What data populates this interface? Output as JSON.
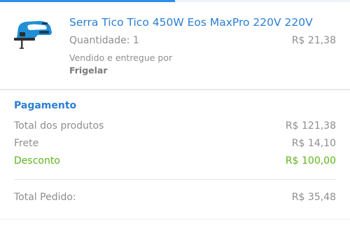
{
  "progress": {
    "fraction": 0.5,
    "color": "#2d8fe8"
  },
  "product": {
    "image_icon": "jigsaw-icon",
    "name": "Serra Tico Tico 450W Eos MaxPro 220V 220V",
    "quantity_label": "Quantidade: 1",
    "price": "R$ 21,38",
    "seller_label": "Vendido e entregue por",
    "seller_name": "Frigelar"
  },
  "payment": {
    "title": "Pagamento",
    "products_label": "Total dos produtos",
    "products_value": "R$ 121,38",
    "shipping_label": "Frete",
    "shipping_value": "R$ 14,10",
    "discount_label": "Desconto",
    "discount_value": "R$ 100,00",
    "total_label": "Total Pedido:",
    "total_value": "R$ 35,48"
  },
  "colors": {
    "accent": "#2a7fd4",
    "discount": "#5fb31b",
    "muted_text": "#8e8e8e"
  }
}
